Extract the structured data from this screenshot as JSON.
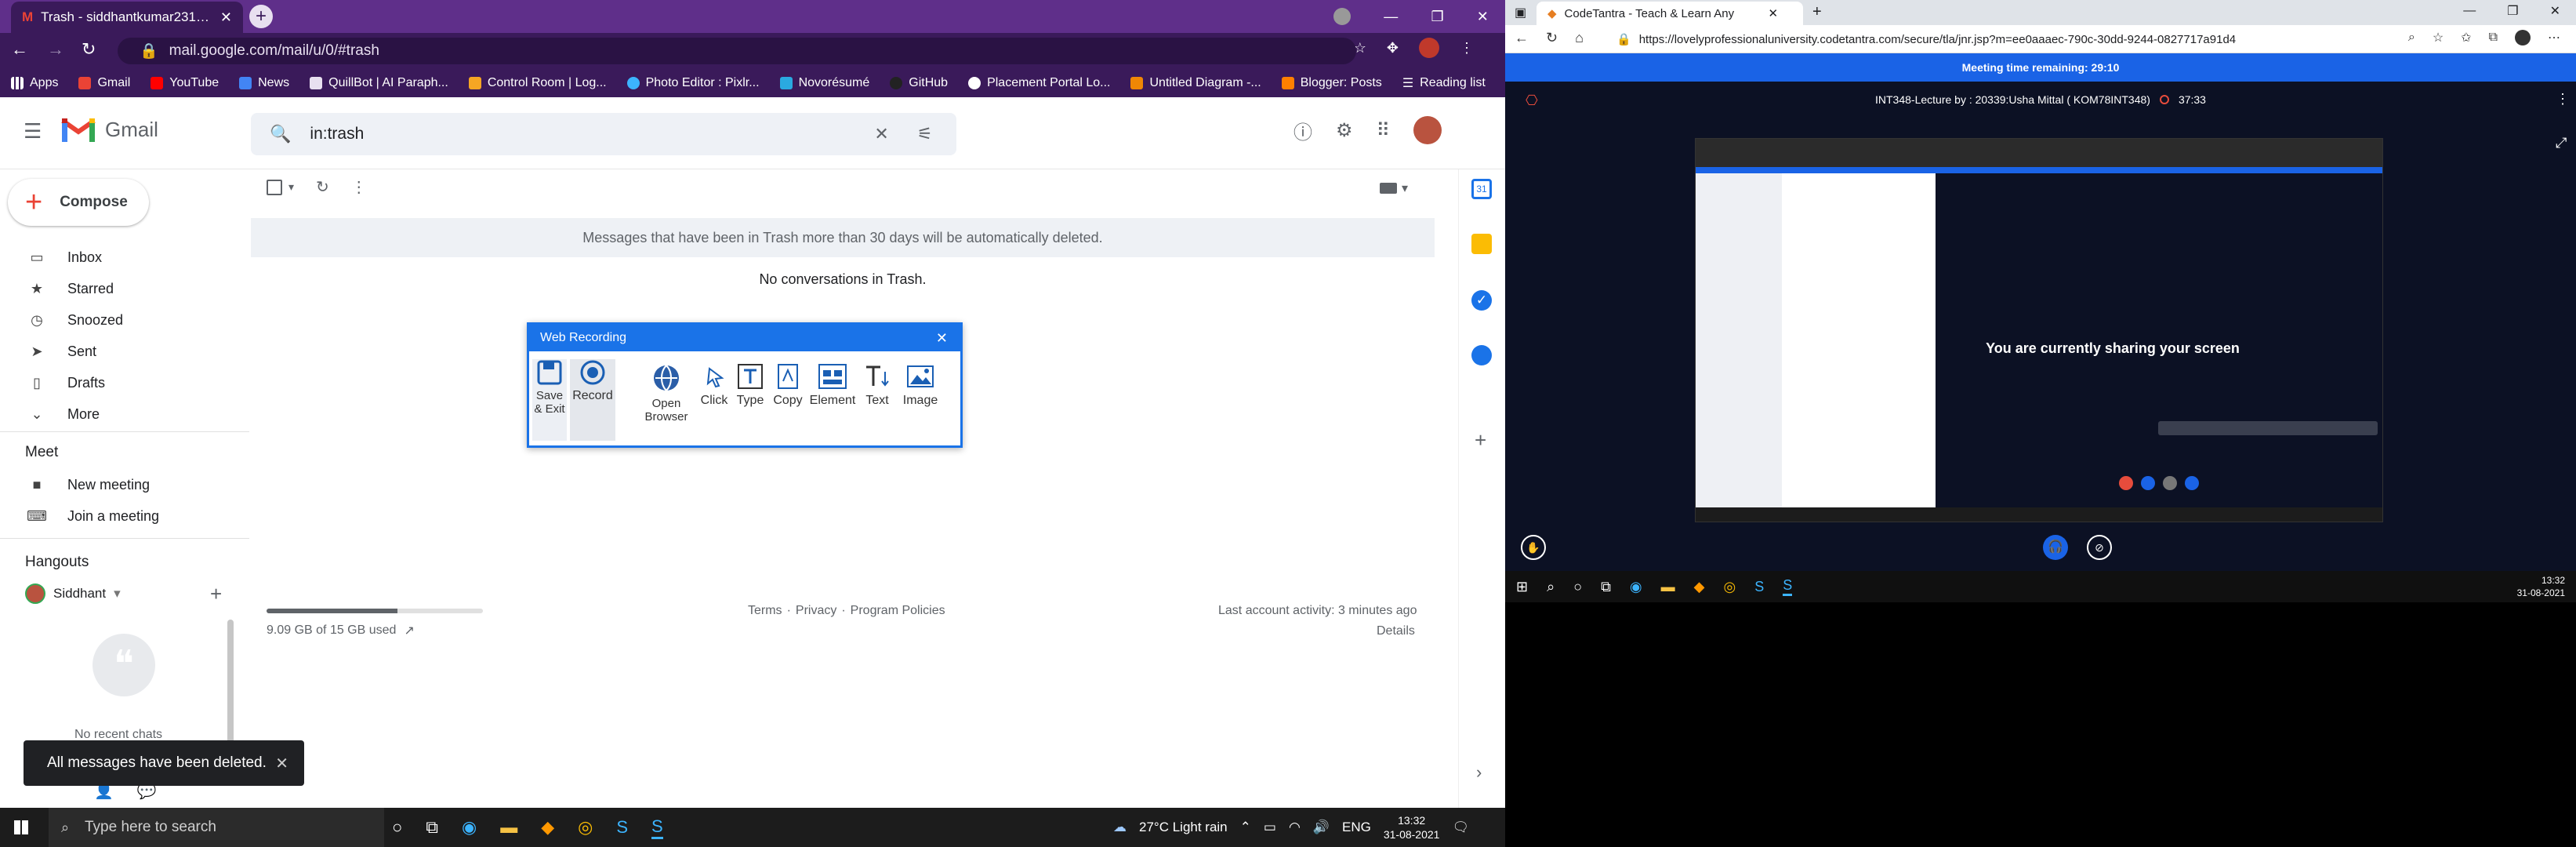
{
  "left_browser": {
    "tab_title": "Trash - siddhantkumar231@gm",
    "url": "mail.google.com/mail/u/0/#trash",
    "bookmarks": [
      {
        "label": "Apps",
        "color": "#fff"
      },
      {
        "label": "Gmail",
        "color": "#ea4335"
      },
      {
        "label": "YouTube",
        "color": "#ff0000"
      },
      {
        "label": "News",
        "color": "#4285f4"
      },
      {
        "label": "QuillBot | AI Paraph...",
        "color": "#e8e0f0"
      },
      {
        "label": "Control Room | Log...",
        "color": "#f6a623"
      },
      {
        "label": "Photo Editor : Pixlr...",
        "color": "#3cb4ff"
      },
      {
        "label": "Novorésumé",
        "color": "#2aa9e0"
      },
      {
        "label": "GitHub",
        "color": "#222"
      },
      {
        "label": "Placement Portal Lo...",
        "color": "#fff"
      },
      {
        "label": "Untitled Diagram -...",
        "color": "#f08705"
      },
      {
        "label": "Blogger: Posts",
        "color": "#ff8000"
      }
    ],
    "reading_list": "Reading list"
  },
  "gmail": {
    "logo": "Gmail",
    "search_value": "in:trash",
    "compose": "Compose",
    "nav": [
      {
        "label": "Inbox",
        "icon": "inbox-icon"
      },
      {
        "label": "Starred",
        "icon": "star-icon"
      },
      {
        "label": "Snoozed",
        "icon": "clock-icon"
      },
      {
        "label": "Sent",
        "icon": "send-icon"
      },
      {
        "label": "Drafts",
        "icon": "draft-icon"
      },
      {
        "label": "More",
        "icon": "chevron-down-icon"
      }
    ],
    "meet_heading": "Meet",
    "meet_items": [
      {
        "label": "New meeting",
        "icon": "video-icon"
      },
      {
        "label": "Join a meeting",
        "icon": "keyboard-icon"
      }
    ],
    "hangouts_heading": "Hangouts",
    "hangouts_user": "Siddhant",
    "no_recent_chats": "No recent chats",
    "trash_notice": "Messages that have been in Trash more than 30 days will be automatically deleted.",
    "empty_message": "No conversations in Trash.",
    "storage_used": "9.09 GB of 15 GB used",
    "storage_fraction": 0.606,
    "footer_links": [
      "Terms",
      "Privacy",
      "Program Policies"
    ],
    "last_activity": "Last account activity: 3 minutes ago",
    "details": "Details",
    "toast": "All messages have been deleted."
  },
  "web_recording": {
    "title": "Web Recording",
    "tools": [
      {
        "label": "Save & Exit",
        "icon": "save-icon"
      },
      {
        "label": "Record",
        "icon": "record-icon"
      },
      {
        "label": "Open Browser",
        "icon": "globe-icon"
      },
      {
        "label": "Click",
        "icon": "click-icon"
      },
      {
        "label": "Type",
        "icon": "type-icon"
      },
      {
        "label": "Copy",
        "icon": "copy-icon"
      },
      {
        "label": "Element",
        "icon": "element-icon"
      },
      {
        "label": "Text",
        "icon": "text-icon"
      },
      {
        "label": "Image",
        "icon": "image-icon"
      }
    ]
  },
  "taskbar": {
    "search_placeholder": "Type here to search",
    "weather": "27°C Light rain",
    "language": "ENG",
    "time": "13:32",
    "date": "31-08-2021"
  },
  "right_browser": {
    "tab_title": "CodeTantra - Teach & Learn Any",
    "url": "https://lovelyprofessionaluniversity.codetantra.com/secure/tla/jnr.jsp?m=ee0aaaec-790c-30dd-9244-0827717a91d4",
    "banner": "Meeting time remaining: 29:10",
    "lecture_title": "INT348-Lecture by : 20339:Usha Mittal ( KOM78INT348)",
    "timer": "37:33",
    "share_text": "You are currently sharing your screen",
    "time": "13:32",
    "date": "31-08-2021"
  }
}
